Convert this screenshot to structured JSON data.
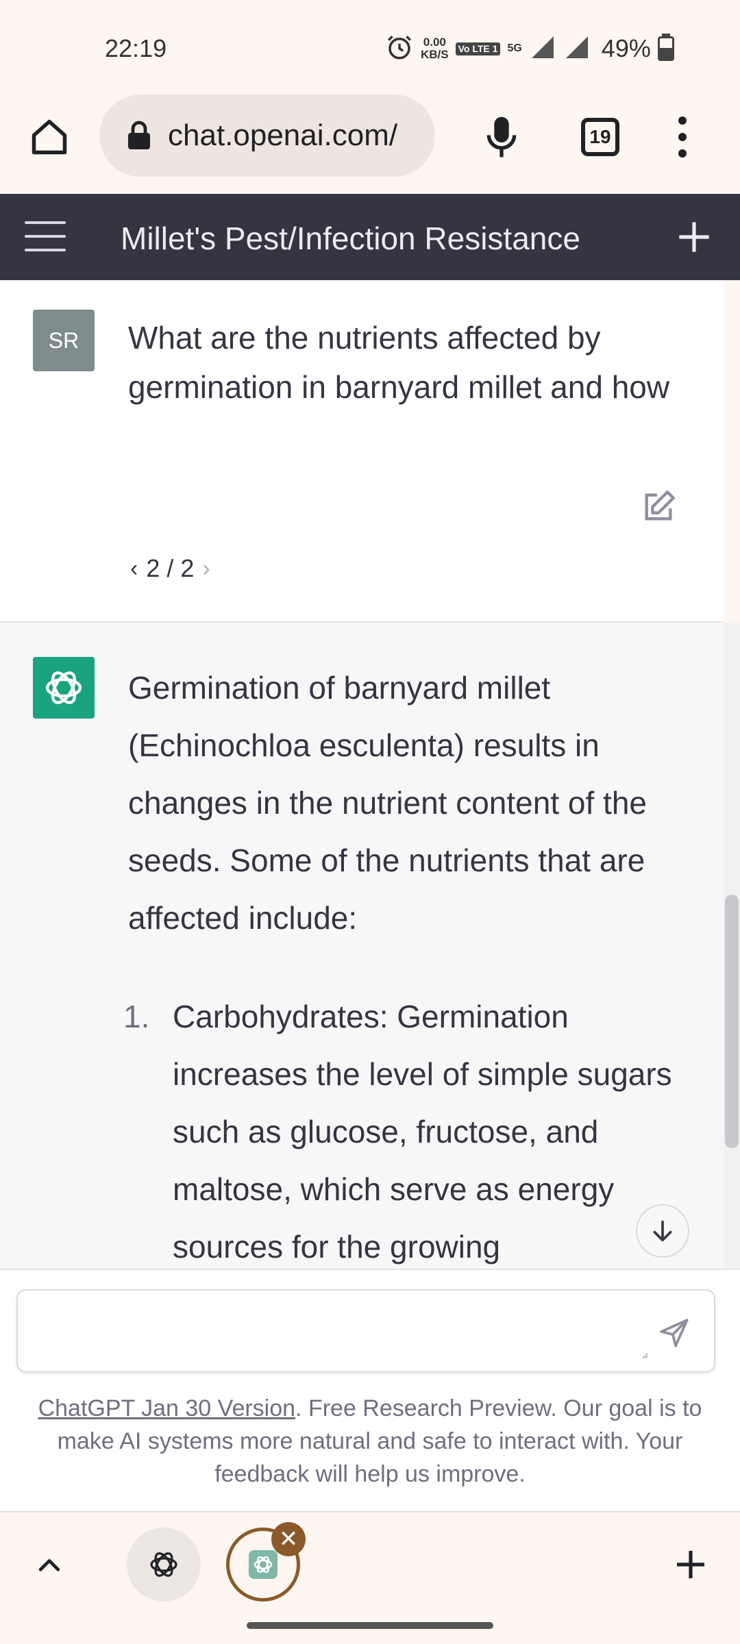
{
  "status_bar": {
    "time": "22:19",
    "net_speed_value": "0.00",
    "net_speed_unit": "KB/S",
    "volte_label": "Vo LTE 1",
    "network": "5G",
    "battery": "49%"
  },
  "browser": {
    "url": "chat.openai.com/",
    "tab_count": "19"
  },
  "chat": {
    "title": "Millet's Pest/Infection Resistance"
  },
  "user_message": {
    "avatar_initials": "SR",
    "text": "What are the nutrients affected by germination in barnyard millet and how",
    "pager": {
      "prev": "‹",
      "current": "2 / 2",
      "next": "›"
    }
  },
  "assistant_message": {
    "intro": "Germination of barnyard millet (Echinochloa esculenta) results in changes in the nutrient content of the seeds. Some of the nutrients that are affected include:",
    "list": [
      {
        "number": "1.",
        "text": "Carbohydrates: Germination increases the level of simple sugars such as glucose, fructose, and maltose, which serve as energy sources for the growing"
      }
    ]
  },
  "composer": {
    "placeholder": ""
  },
  "footer": {
    "link_text": "ChatGPT Jan 30 Version",
    "note": ". Free Research Preview. Our goal is to make AI systems more natural and safe to interact with. Your feedback will help us improve."
  },
  "tab_strip": {
    "close_glyph": "✕"
  },
  "colors": {
    "header_bg": "#343541",
    "gpt_green": "#19a37f",
    "user_avatar": "#7f8c8d",
    "assistant_bg": "#f7f7f8",
    "browser_bg": "#fdf6f1"
  }
}
